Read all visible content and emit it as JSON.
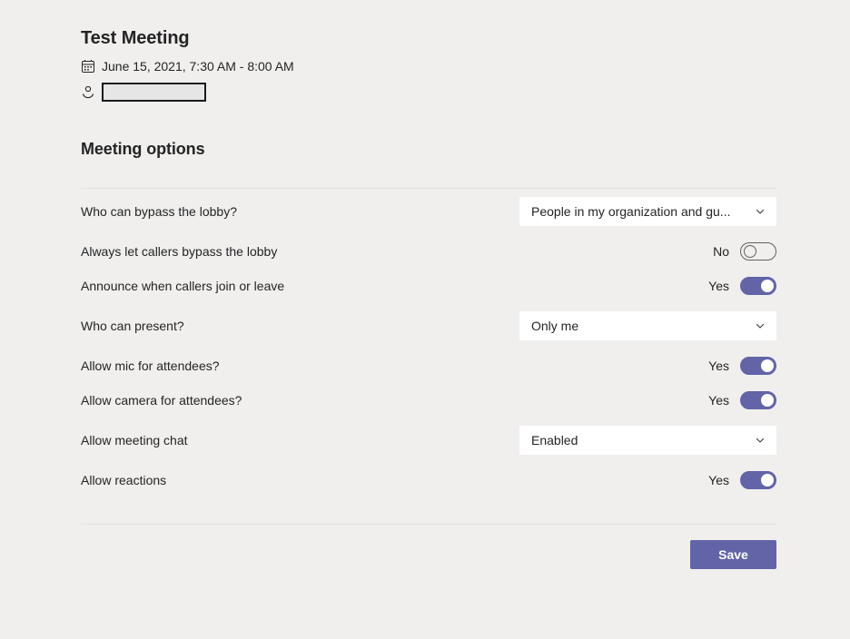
{
  "theme": {
    "background": "#f0efee",
    "accent": "#6264a7",
    "text": "#242424",
    "surface": "#ffffff",
    "divider": "#e3e1e0"
  },
  "header": {
    "meeting_title": "Test Meeting",
    "date_icon": "calendar-icon",
    "date_time": "June 15, 2021, 7:30 AM - 8:00 AM",
    "organizer_icon": "person-icon",
    "organizer_name": ""
  },
  "section": {
    "title": "Meeting options"
  },
  "options": [
    {
      "label": "Who can bypass the lobby?",
      "control": "dropdown",
      "name": "who-can-bypass-lobby",
      "value": "People in my organization and gu...",
      "icon": "chevron-down-icon"
    },
    {
      "label": "Always let callers bypass the lobby",
      "control": "toggle",
      "name": "always-let-callers-bypass-lobby",
      "state_label": "No",
      "on": false
    },
    {
      "label": "Announce when callers join or leave",
      "control": "toggle",
      "name": "announce-when-callers-join-or-leave",
      "state_label": "Yes",
      "on": true
    },
    {
      "label": "Who can present?",
      "control": "dropdown",
      "name": "who-can-present",
      "value": "Only me",
      "icon": "chevron-down-icon"
    },
    {
      "label": "Allow mic for attendees?",
      "control": "toggle",
      "name": "allow-mic-for-attendees",
      "state_label": "Yes",
      "on": true
    },
    {
      "label": "Allow camera for attendees?",
      "control": "toggle",
      "name": "allow-camera-for-attendees",
      "state_label": "Yes",
      "on": true
    },
    {
      "label": "Allow meeting chat",
      "control": "dropdown",
      "name": "allow-meeting-chat",
      "value": "Enabled",
      "icon": "chevron-down-icon"
    },
    {
      "label": "Allow reactions",
      "control": "toggle",
      "name": "allow-reactions",
      "state_label": "Yes",
      "on": true
    }
  ],
  "footer": {
    "save_label": "Save"
  }
}
